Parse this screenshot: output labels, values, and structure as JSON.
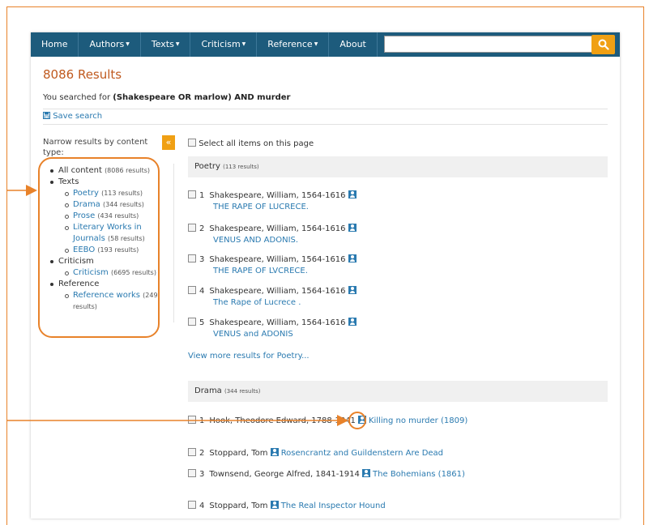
{
  "navbar": {
    "items": [
      {
        "label": "Home",
        "caret": false
      },
      {
        "label": "Authors",
        "caret": true
      },
      {
        "label": "Texts",
        "caret": true
      },
      {
        "label": "Criticism",
        "caret": true
      },
      {
        "label": "Reference",
        "caret": true
      },
      {
        "label": "About",
        "caret": false
      }
    ],
    "search_value": ""
  },
  "results": {
    "count_label": "8086 Results",
    "searched_prefix": "You searched for ",
    "query": "(Shakespeare OR marlow) AND murder",
    "save_search": "Save search"
  },
  "sidebar": {
    "narrow_label": "Narrow results by content type:",
    "collapse_symbol": "«",
    "facets": [
      {
        "level": 1,
        "label": "All content",
        "count": "(8086 results)",
        "link": false
      },
      {
        "level": 1,
        "label": "Texts",
        "count": "",
        "link": false
      },
      {
        "level": 2,
        "label": "Poetry",
        "count": "(113 results)",
        "link": true
      },
      {
        "level": 2,
        "label": "Drama",
        "count": "(344 results)",
        "link": true
      },
      {
        "level": 2,
        "label": "Prose",
        "count": "(434 results)",
        "link": true
      },
      {
        "level": 2,
        "label": "Literary Works in Journals",
        "count": "(58 results)",
        "link": true
      },
      {
        "level": 2,
        "label": "EEBO",
        "count": "(193 results)",
        "link": true
      },
      {
        "level": 1,
        "label": "Criticism",
        "count": "",
        "link": false
      },
      {
        "level": 2,
        "label": "Criticism",
        "count": "(6695 results)",
        "link": true
      },
      {
        "level": 1,
        "label": "Reference",
        "count": "",
        "link": false
      },
      {
        "level": 2,
        "label": "Reference works",
        "count": "(249 results)",
        "link": true
      }
    ]
  },
  "main": {
    "select_all": "Select all items on this page",
    "groups": [
      {
        "name": "Poetry",
        "count": "(113 results)",
        "items": [
          {
            "num": "1",
            "author": "Shakespeare, William, 1564-1616",
            "title": "THE RAPE OF LUCRECE."
          },
          {
            "num": "2",
            "author": "Shakespeare, William, 1564-1616",
            "title": "VENUS AND ADONIS."
          },
          {
            "num": "3",
            "author": "Shakespeare, William, 1564-1616",
            "title": "THE RAPE OF LVCRECE."
          },
          {
            "num": "4",
            "author": "Shakespeare, William, 1564-1616",
            "title": "The Rape of Lucrece ."
          },
          {
            "num": "5",
            "author": "Shakespeare, William, 1564-1616",
            "title": "VENUS and ADONIS"
          }
        ],
        "more": "View more results for Poetry..."
      },
      {
        "name": "Drama",
        "count": "(344 results)",
        "items": [
          {
            "num": "1",
            "author": "Hook, Theodore Edward, 1788-1841",
            "title": "Killing no murder (1809)"
          },
          {
            "num": "2",
            "author": "Stoppard, Tom",
            "title": "Rosencrantz and Guildenstern Are Dead"
          },
          {
            "num": "3",
            "author": "Townsend, George Alfred, 1841-1914",
            "title": "The Bohemians (1861)"
          },
          {
            "num": "4",
            "author": "Stoppard, Tom",
            "title": "The Real Inspector Hound"
          }
        ]
      }
    ]
  },
  "colors": {
    "navbar": "#1d5b7c",
    "accent_orange": "#f0a014",
    "results_title": "#c05a1f",
    "link": "#2a7ab0",
    "annotation": "#e8822a"
  },
  "icons": {
    "search": "magnifier-icon",
    "save": "save-icon",
    "author": "person-icon",
    "collapse": "double-chevron-left-icon"
  }
}
